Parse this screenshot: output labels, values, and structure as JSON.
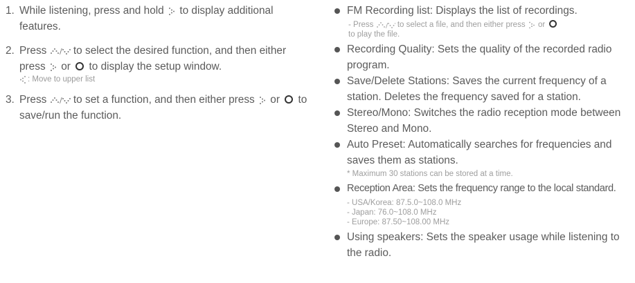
{
  "steps": [
    {
      "num": "1.",
      "before": "While listening, press and hold",
      "after": "to display additional features."
    },
    {
      "num": "2.",
      "before": "Press",
      "mid": "to select the desired function, and then either press",
      "or": "or",
      "after": "to display the setup window.",
      "note": ": Move to upper list"
    },
    {
      "num": "3.",
      "before": "Press",
      "mid": "to set a function, and then either press",
      "or": "or",
      "after": "to save/run the function."
    }
  ],
  "items": [
    {
      "text": "FM Recording list: Displays the list of recordings.",
      "sub_press": "- Press",
      "sub_mid": "to select a file, and then either press",
      "sub_or": "or",
      "sub_end": "to play the file."
    },
    {
      "text": "Recording Quality: Sets the quality of the recorded radio program."
    },
    {
      "text": "Save/Delete Stations: Saves the current frequency of a station. Deletes the frequency saved for a station."
    },
    {
      "text": "Stereo/Mono: Switches the radio reception mode between Stereo and Mono."
    },
    {
      "text": "Auto Preset: Automatically searches for frequencies and saves them as stations.",
      "note": "* Maximum 30 stations can be stored at a time."
    },
    {
      "text": "Reception Area: Sets the frequency range to the local standard.",
      "sub": [
        "- USA/Korea: 87.5.0~108.0 MHz",
        "- Japan: 76.0~108.0 MHz",
        "- Europe: 87.50~108.00 MHz"
      ]
    },
    {
      "text": "Using speakers: Sets the speaker usage while listening to the radio."
    }
  ],
  "icons": {
    "right": "right-arrow-dotted-icon",
    "updown": "up-down-arrows-dotted-icon",
    "left": "left-arrow-dotted-icon",
    "ok": "ok-circle-icon"
  }
}
